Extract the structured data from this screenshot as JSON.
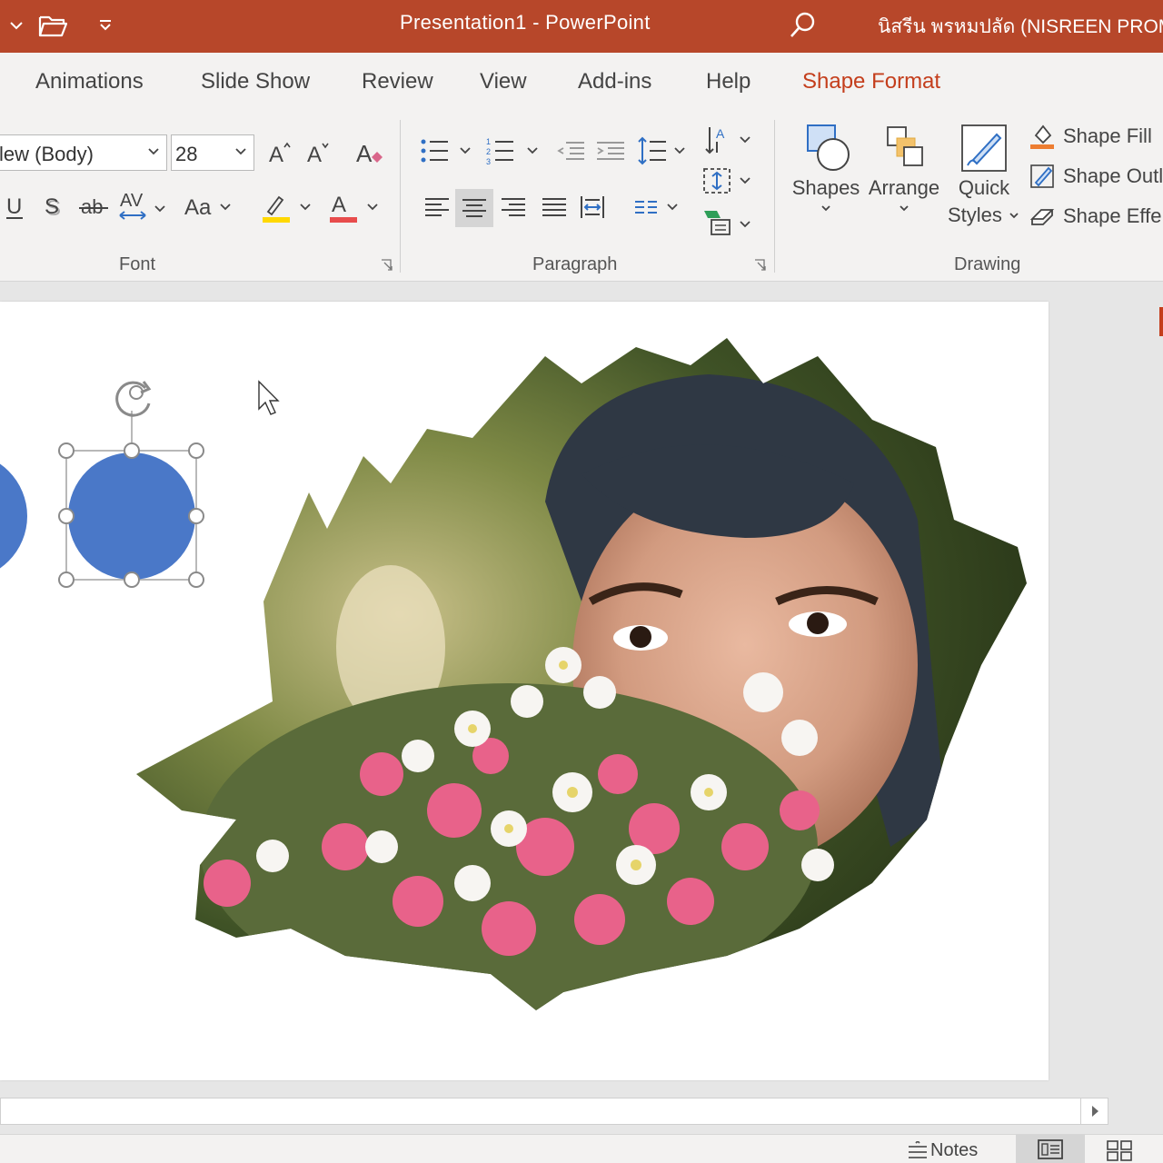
{
  "titlebar": {
    "title": "Presentation1  -  PowerPoint",
    "user": "นิสรีน พรหมปลัด (NISREEN PROM",
    "bg_color": "#b7472a"
  },
  "tabs": [
    {
      "label": "Animations"
    },
    {
      "label": "Slide Show"
    },
    {
      "label": "Review"
    },
    {
      "label": "View"
    },
    {
      "label": "Add-ins"
    },
    {
      "label": "Help"
    },
    {
      "label": "Shape Format",
      "active": true
    }
  ],
  "font_group": {
    "font_name": "lew (Body)",
    "font_size": "28",
    "label": "Font",
    "highlight_color": "#ffd800",
    "font_color": "#e84c4c"
  },
  "paragraph_group": {
    "label": "Paragraph"
  },
  "drawing_group": {
    "label": "Drawing",
    "shapes_label": "Shapes",
    "arrange_label": "Arrange",
    "quick_styles_line1": "Quick",
    "quick_styles_line2": "Styles",
    "shape_fill": "Shape Fill",
    "shape_outline": "Shape Outl",
    "shape_effects": "Shape Effe"
  },
  "slide": {
    "circle_color": "#4a78c8",
    "photo_description_icon": "portrait-with-flowers"
  },
  "statusbar": {
    "notes_label": "Notes"
  }
}
